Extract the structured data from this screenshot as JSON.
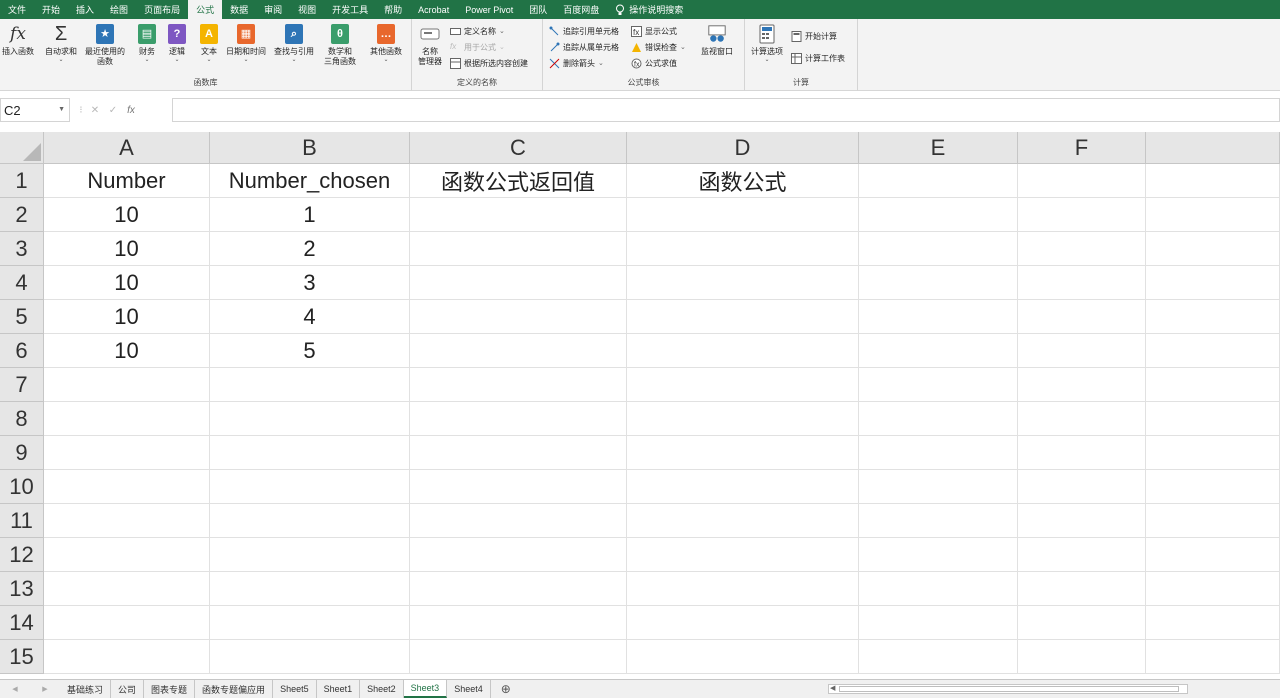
{
  "menubar": {
    "tabs": [
      "文件",
      "开始",
      "插入",
      "绘图",
      "页面布局",
      "公式",
      "数据",
      "审阅",
      "视图",
      "开发工具",
      "帮助",
      "Acrobat",
      "Power Pivot",
      "团队",
      "百度网盘"
    ],
    "active": "公式",
    "search_label": "操作说明搜索"
  },
  "ribbon": {
    "function_library": {
      "insert_function": "插入函数",
      "autosum": "自动求和",
      "recently_used_1": "最近使用的",
      "recently_used_2": "函数",
      "financial": "财务",
      "logical": "逻辑",
      "text": "文本",
      "datetime": "日期和时间",
      "lookup": "查找与引用",
      "math_1": "数学和",
      "math_2": "三角函数",
      "more": "其他函数",
      "group_label": "函数库"
    },
    "defined_names": {
      "name_manager_1": "名称",
      "name_manager_2": "管理器",
      "define_name": "定义名称",
      "use_in_formula": "用于公式",
      "create_from_selection": "根据所选内容创建",
      "group_label": "定义的名称"
    },
    "formula_auditing": {
      "trace_precedents": "追踪引用单元格",
      "trace_dependents": "追踪从属单元格",
      "remove_arrows": "删除箭头",
      "show_formulas": "显示公式",
      "error_checking": "错误检查",
      "evaluate_formula": "公式求值",
      "watch_window": "监视窗口",
      "group_label": "公式审核"
    },
    "calculation": {
      "calc_options": "计算选项",
      "calc_now": "开始计算",
      "calc_sheet": "计算工作表",
      "group_label": "计算"
    }
  },
  "formula_bar": {
    "name_box": "C2",
    "formula": ""
  },
  "grid": {
    "columns": [
      "A",
      "B",
      "C",
      "D",
      "E",
      "F"
    ],
    "rows": [
      "1",
      "2",
      "3",
      "4",
      "5",
      "6",
      "7",
      "8",
      "9",
      "10",
      "11",
      "12",
      "13",
      "14",
      "15"
    ],
    "cells": [
      [
        "Number",
        "Number_chosen",
        "函数公式返回值",
        "函数公式",
        "",
        ""
      ],
      [
        "10",
        "1",
        "",
        "",
        "",
        ""
      ],
      [
        "10",
        "2",
        "",
        "",
        "",
        ""
      ],
      [
        "10",
        "3",
        "",
        "",
        "",
        ""
      ],
      [
        "10",
        "4",
        "",
        "",
        "",
        ""
      ],
      [
        "10",
        "5",
        "",
        "",
        "",
        ""
      ],
      [
        "",
        "",
        "",
        "",
        "",
        ""
      ],
      [
        "",
        "",
        "",
        "",
        "",
        ""
      ],
      [
        "",
        "",
        "",
        "",
        "",
        ""
      ],
      [
        "",
        "",
        "",
        "",
        "",
        ""
      ],
      [
        "",
        "",
        "",
        "",
        "",
        ""
      ],
      [
        "",
        "",
        "",
        "",
        "",
        ""
      ],
      [
        "",
        "",
        "",
        "",
        "",
        ""
      ],
      [
        "",
        "",
        "",
        "",
        "",
        ""
      ],
      [
        "",
        "",
        "",
        "",
        "",
        ""
      ]
    ]
  },
  "sheet_tabs": {
    "tabs": [
      "基础练习",
      "公司",
      "图表专题",
      "函数专题偏应用",
      "Sheet5",
      "Sheet1",
      "Sheet2",
      "Sheet3",
      "Sheet4"
    ],
    "active": "Sheet3"
  },
  "colors": {
    "brand": "#217346",
    "header_bg": "#e6e6e6",
    "ribbon_bg": "#f3f3f3"
  }
}
